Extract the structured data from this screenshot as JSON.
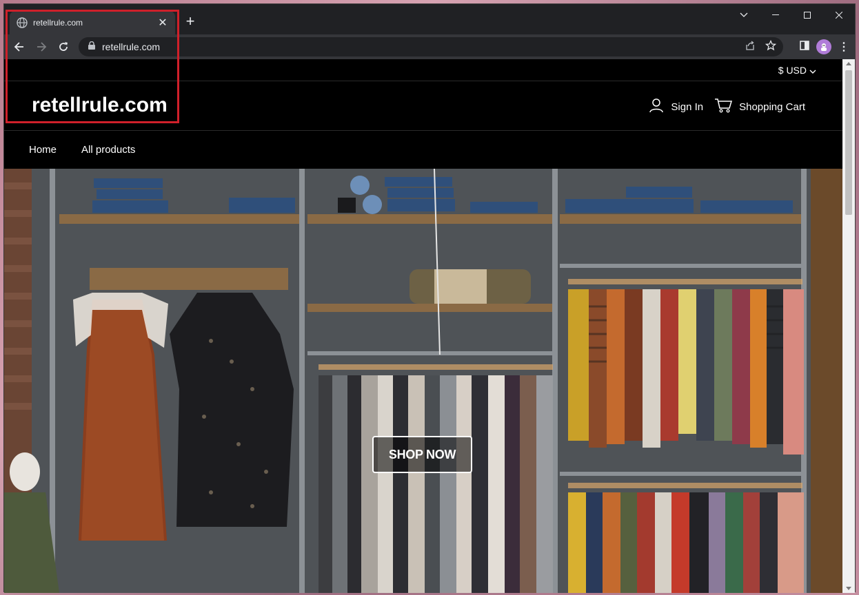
{
  "browser": {
    "tab_title": "retellrule.com",
    "url": "retellrule.com",
    "newtab_label": "+"
  },
  "site": {
    "currency": "$ USD",
    "logo": "retellrule.com",
    "sign_in": "Sign In",
    "cart": "Shopping Cart",
    "nav": [
      "Home",
      "All products"
    ],
    "cta": "SHOP NOW"
  },
  "colors": {
    "highlight": "#d0202a",
    "page_bg": "#000000"
  }
}
